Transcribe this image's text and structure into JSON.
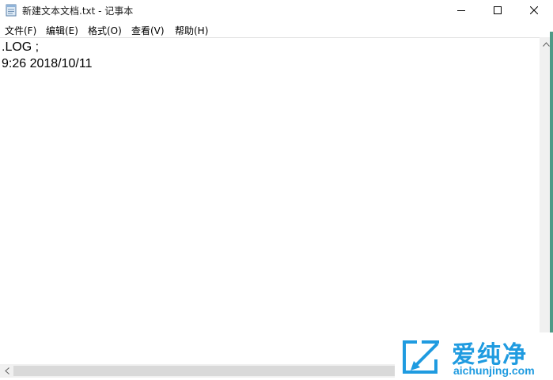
{
  "window": {
    "title": "新建文本文档.txt - 记事本"
  },
  "menu": {
    "items": [
      "文件(F)",
      "编辑(E)",
      "格式(O)",
      "查看(V)",
      "帮助(H)"
    ]
  },
  "editor": {
    "lines": [
      ".LOG ;",
      "9:26 2018/10/11"
    ]
  },
  "watermark": {
    "name_cn": "爱纯净",
    "url": "aichunjing.com"
  },
  "icons": {
    "app": "notepad-icon",
    "minimize": "minimize-icon",
    "maximize": "maximize-icon",
    "close": "close-icon",
    "scroll_up": "arrow-up-icon",
    "scroll_left": "arrow-left-icon"
  },
  "colors": {
    "watermark_blue": "#1f9be0",
    "desktop_green": "#4f9a86"
  }
}
